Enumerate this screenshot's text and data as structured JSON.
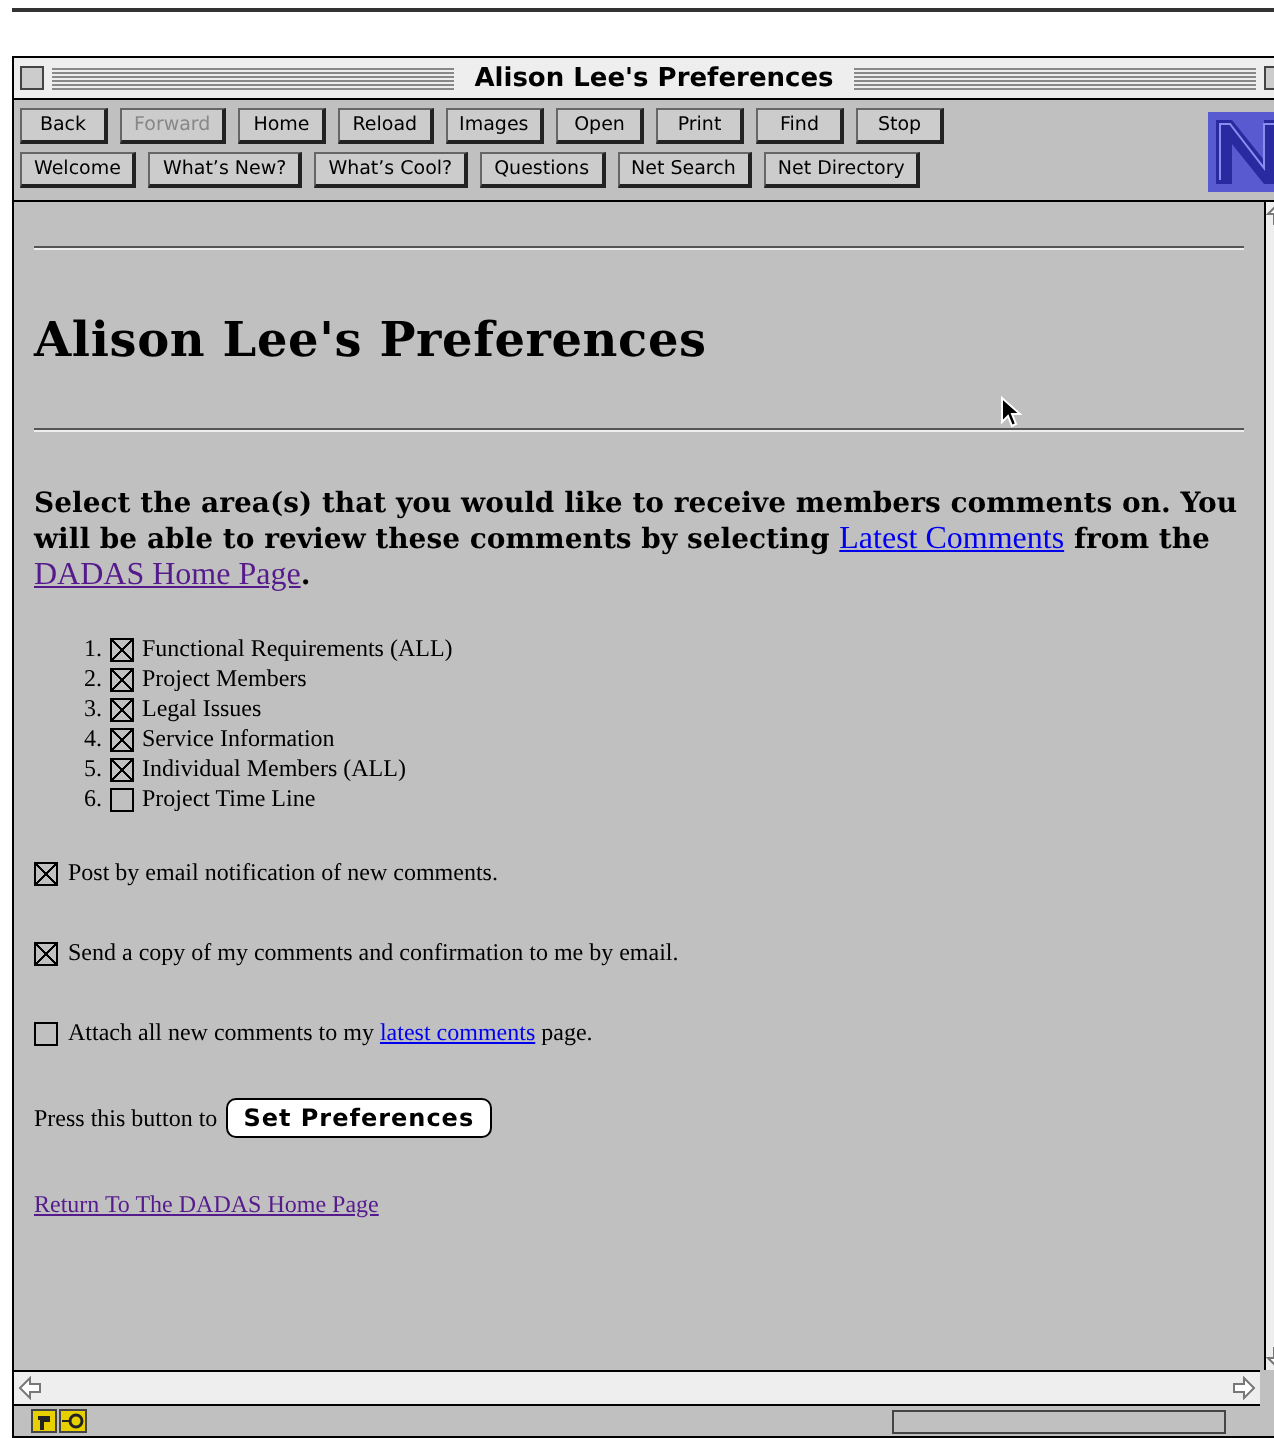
{
  "window": {
    "title": "Alison Lee's Preferences"
  },
  "toolbar": {
    "navigation_buttons": [
      {
        "label": "Back",
        "disabled": false
      },
      {
        "label": "Forward",
        "disabled": true
      },
      {
        "label": "Home",
        "disabled": false
      },
      {
        "label": "Reload",
        "disabled": false
      },
      {
        "label": "Images",
        "disabled": false
      },
      {
        "label": "Open",
        "disabled": false
      },
      {
        "label": "Print",
        "disabled": false
      },
      {
        "label": "Find",
        "disabled": false
      },
      {
        "label": "Stop",
        "disabled": false
      }
    ],
    "directory_buttons": [
      {
        "label": "Welcome",
        "disabled": false
      },
      {
        "label": "What’s New?",
        "disabled": false
      },
      {
        "label": "What’s Cool?",
        "disabled": false
      },
      {
        "label": "Questions",
        "disabled": false
      },
      {
        "label": "Net Search",
        "disabled": false
      },
      {
        "label": "Net Directory",
        "disabled": false
      }
    ]
  },
  "page": {
    "heading": "Alison Lee's Preferences",
    "intro": {
      "before": "Select the area(s) that you would like to receive members comments on. You will be able to review these comments by selecting ",
      "link1": "Latest Comments",
      "middle": " from the ",
      "link2": "DADAS Home Page",
      "after": "."
    },
    "areas": [
      {
        "number": "1.",
        "label": "Functional Requirements (ALL)",
        "checked": true
      },
      {
        "number": "2.",
        "label": "Project Members",
        "checked": true
      },
      {
        "number": "3.",
        "label": "Legal Issues",
        "checked": true
      },
      {
        "number": "4.",
        "label": "Service Information",
        "checked": true
      },
      {
        "number": "5.",
        "label": "Individual Members (ALL)",
        "checked": true
      },
      {
        "number": "6.",
        "label": "Project Time Line",
        "checked": false
      }
    ],
    "options": [
      {
        "before": "Post by email notification of new comments.",
        "checked": true
      },
      {
        "before": "Send a copy of my comments and confirmation to me by email.",
        "checked": true
      },
      {
        "before": "Attach all new comments to my ",
        "link": "latest comments",
        "after": " page.",
        "checked": false
      }
    ],
    "submit": {
      "prompt": "Press this button to",
      "button": "Set Preferences"
    },
    "return_link": "Return To The DADAS Home Page"
  }
}
